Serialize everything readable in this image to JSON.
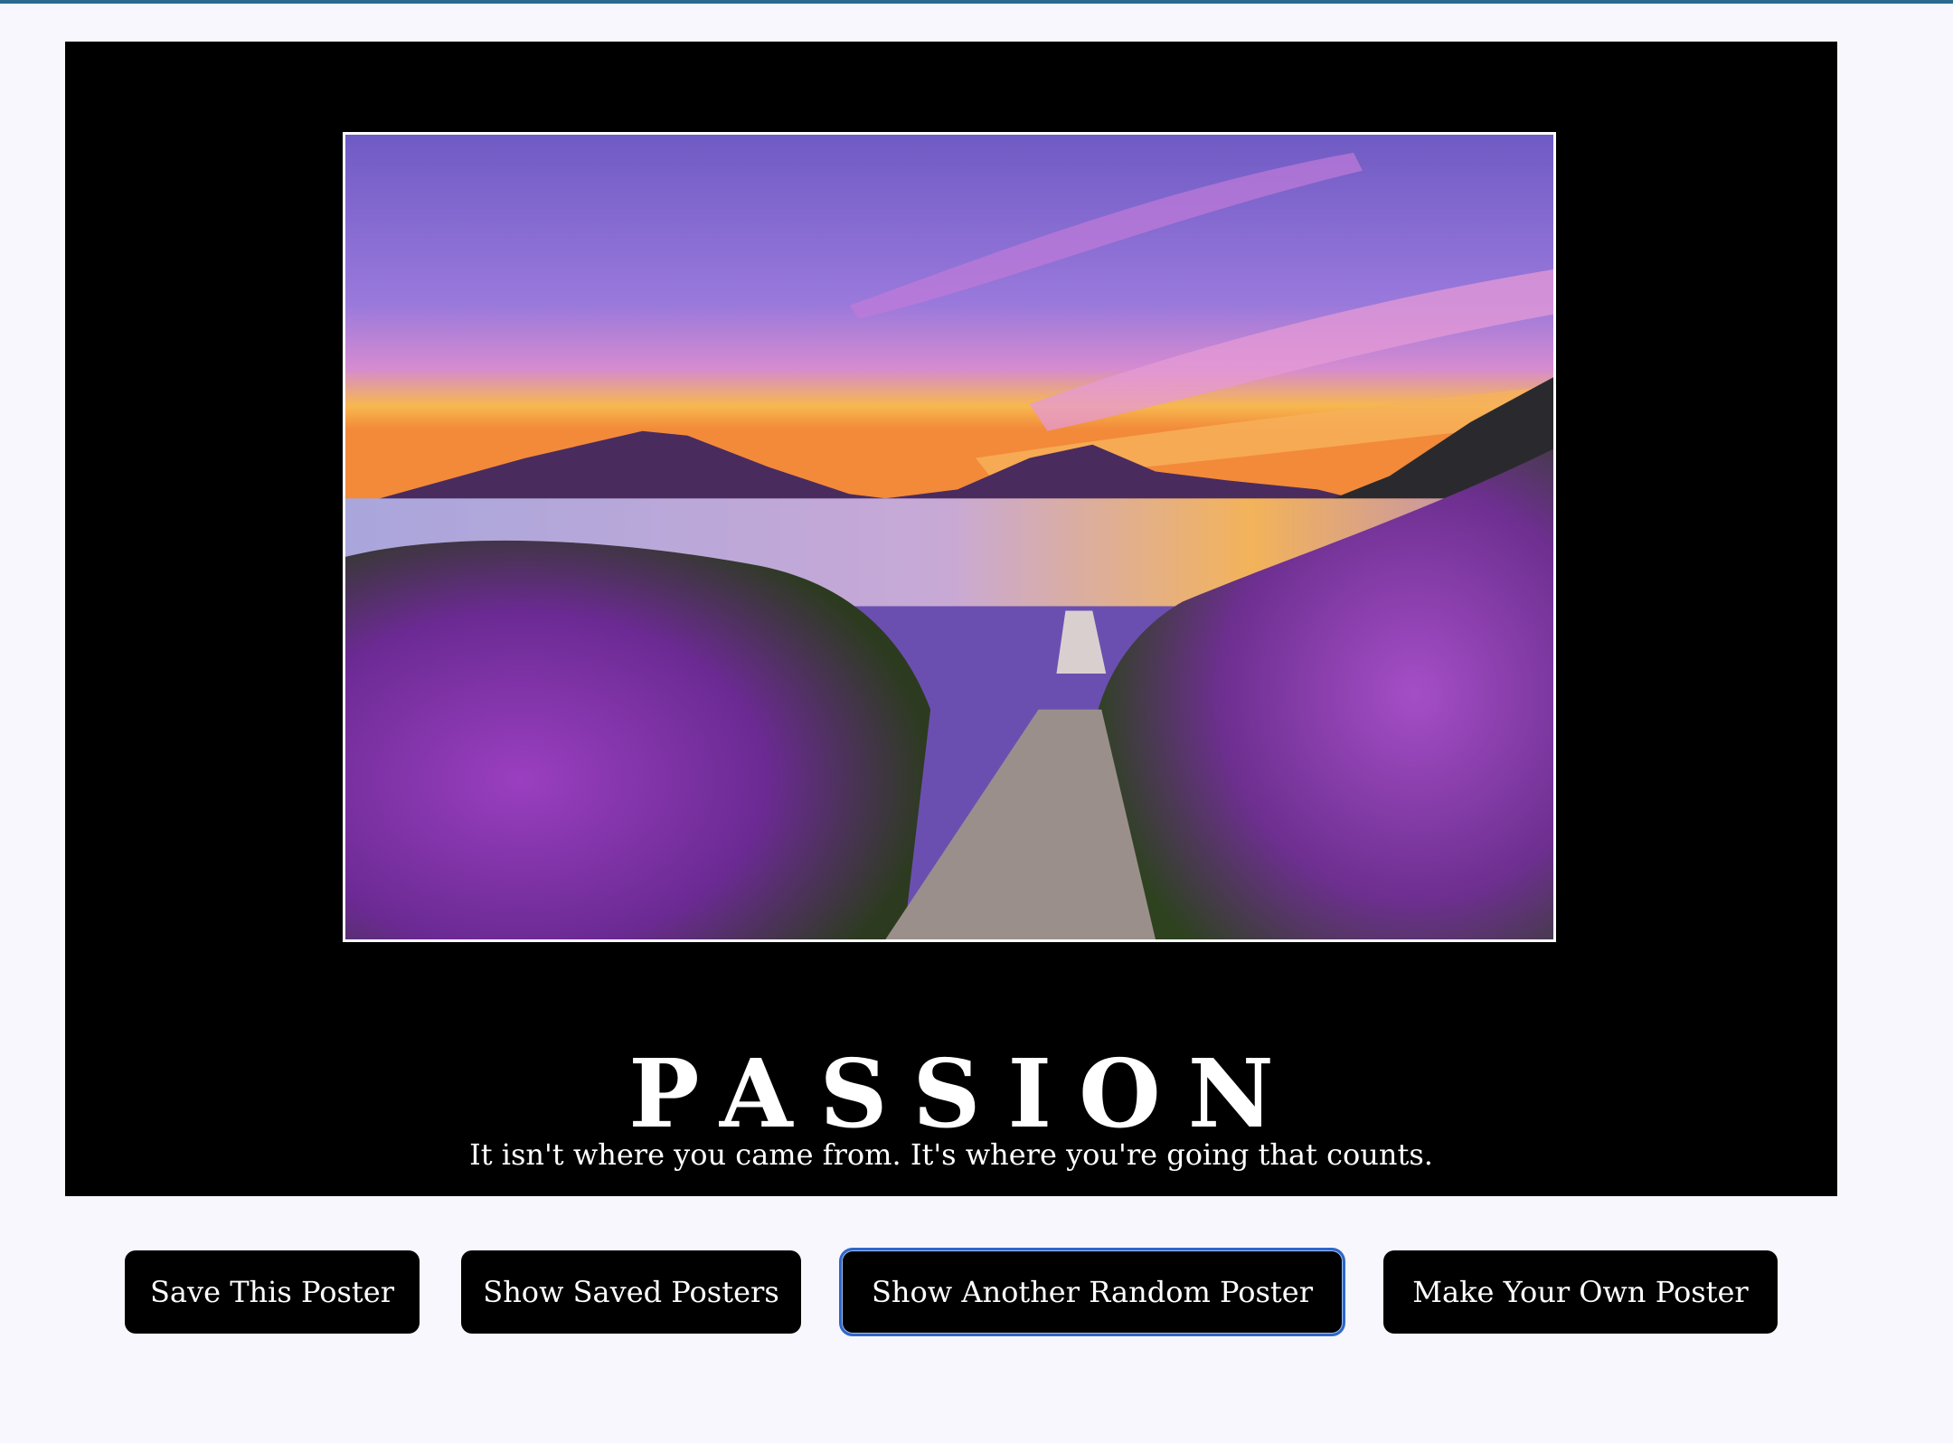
{
  "poster": {
    "title": "PASSION",
    "quote": "It isn't where you came from. It's where you're going that counts.",
    "image": {
      "depicts": "lake-sunset-lavender-path"
    }
  },
  "buttons": {
    "save": "Save This Poster",
    "show_saved": "Show Saved Posters",
    "random": "Show Another Random Poster",
    "make_own": "Make Your Own Poster"
  },
  "colors": {
    "page_background": "#f7f7fd",
    "poster_background": "#000000",
    "button_background": "#000000",
    "button_text": "#ffffff",
    "focus_outline": "#2f67c9"
  }
}
